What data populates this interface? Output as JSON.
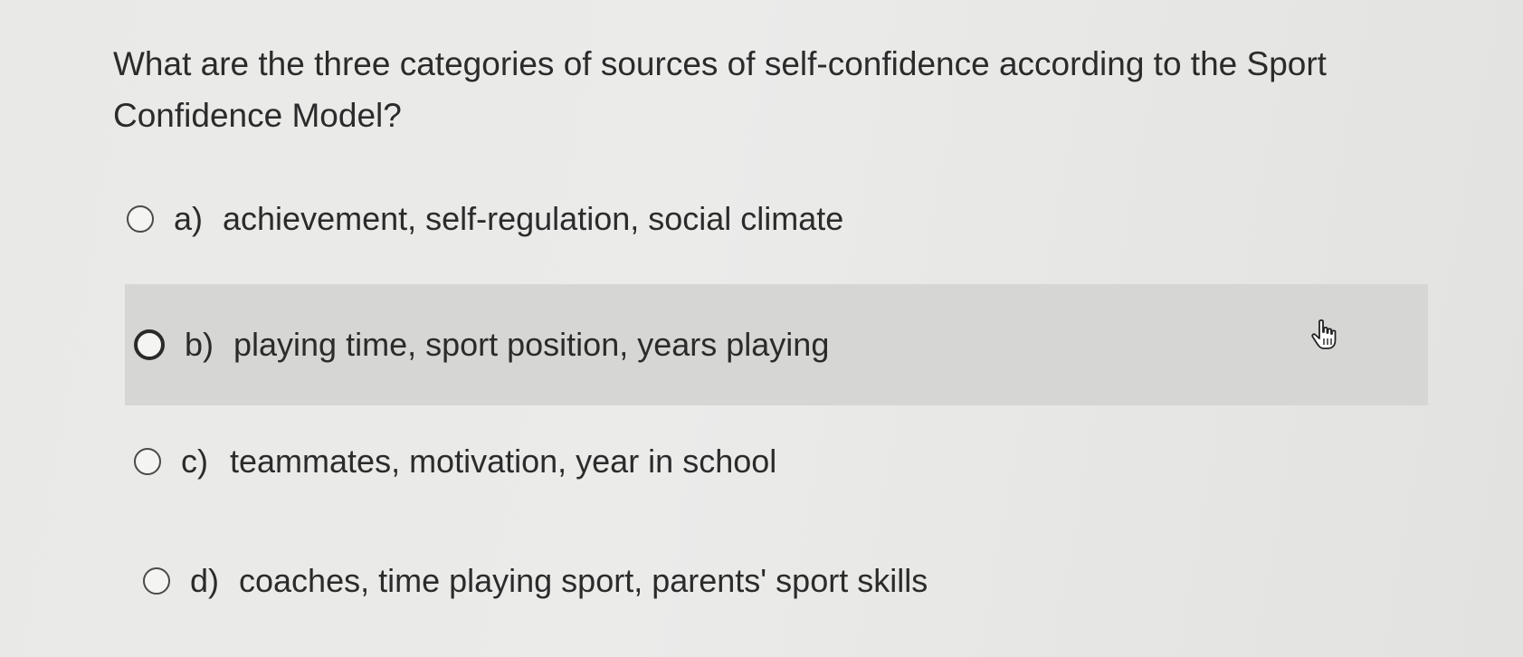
{
  "question": {
    "text": "What are the three categories of sources of self-confidence according to the Sport Confidence Model?"
  },
  "options": [
    {
      "letter": "a)",
      "text": "achievement, self-regulation, social climate",
      "selected": false,
      "hovered": false
    },
    {
      "letter": "b)",
      "text": "playing time, sport position, years playing",
      "selected": false,
      "hovered": true
    },
    {
      "letter": "c)",
      "text": "teammates, motivation, year in school",
      "selected": false,
      "hovered": false
    },
    {
      "letter": "d)",
      "text": "coaches, time playing sport, parents' sport skills",
      "selected": false,
      "hovered": false
    }
  ],
  "colors": {
    "background": "#e9e9e7",
    "hover_row": "#d6d6d4",
    "text": "#2b2b2b"
  },
  "cursor": {
    "icon": "hand-pointer-icon"
  }
}
